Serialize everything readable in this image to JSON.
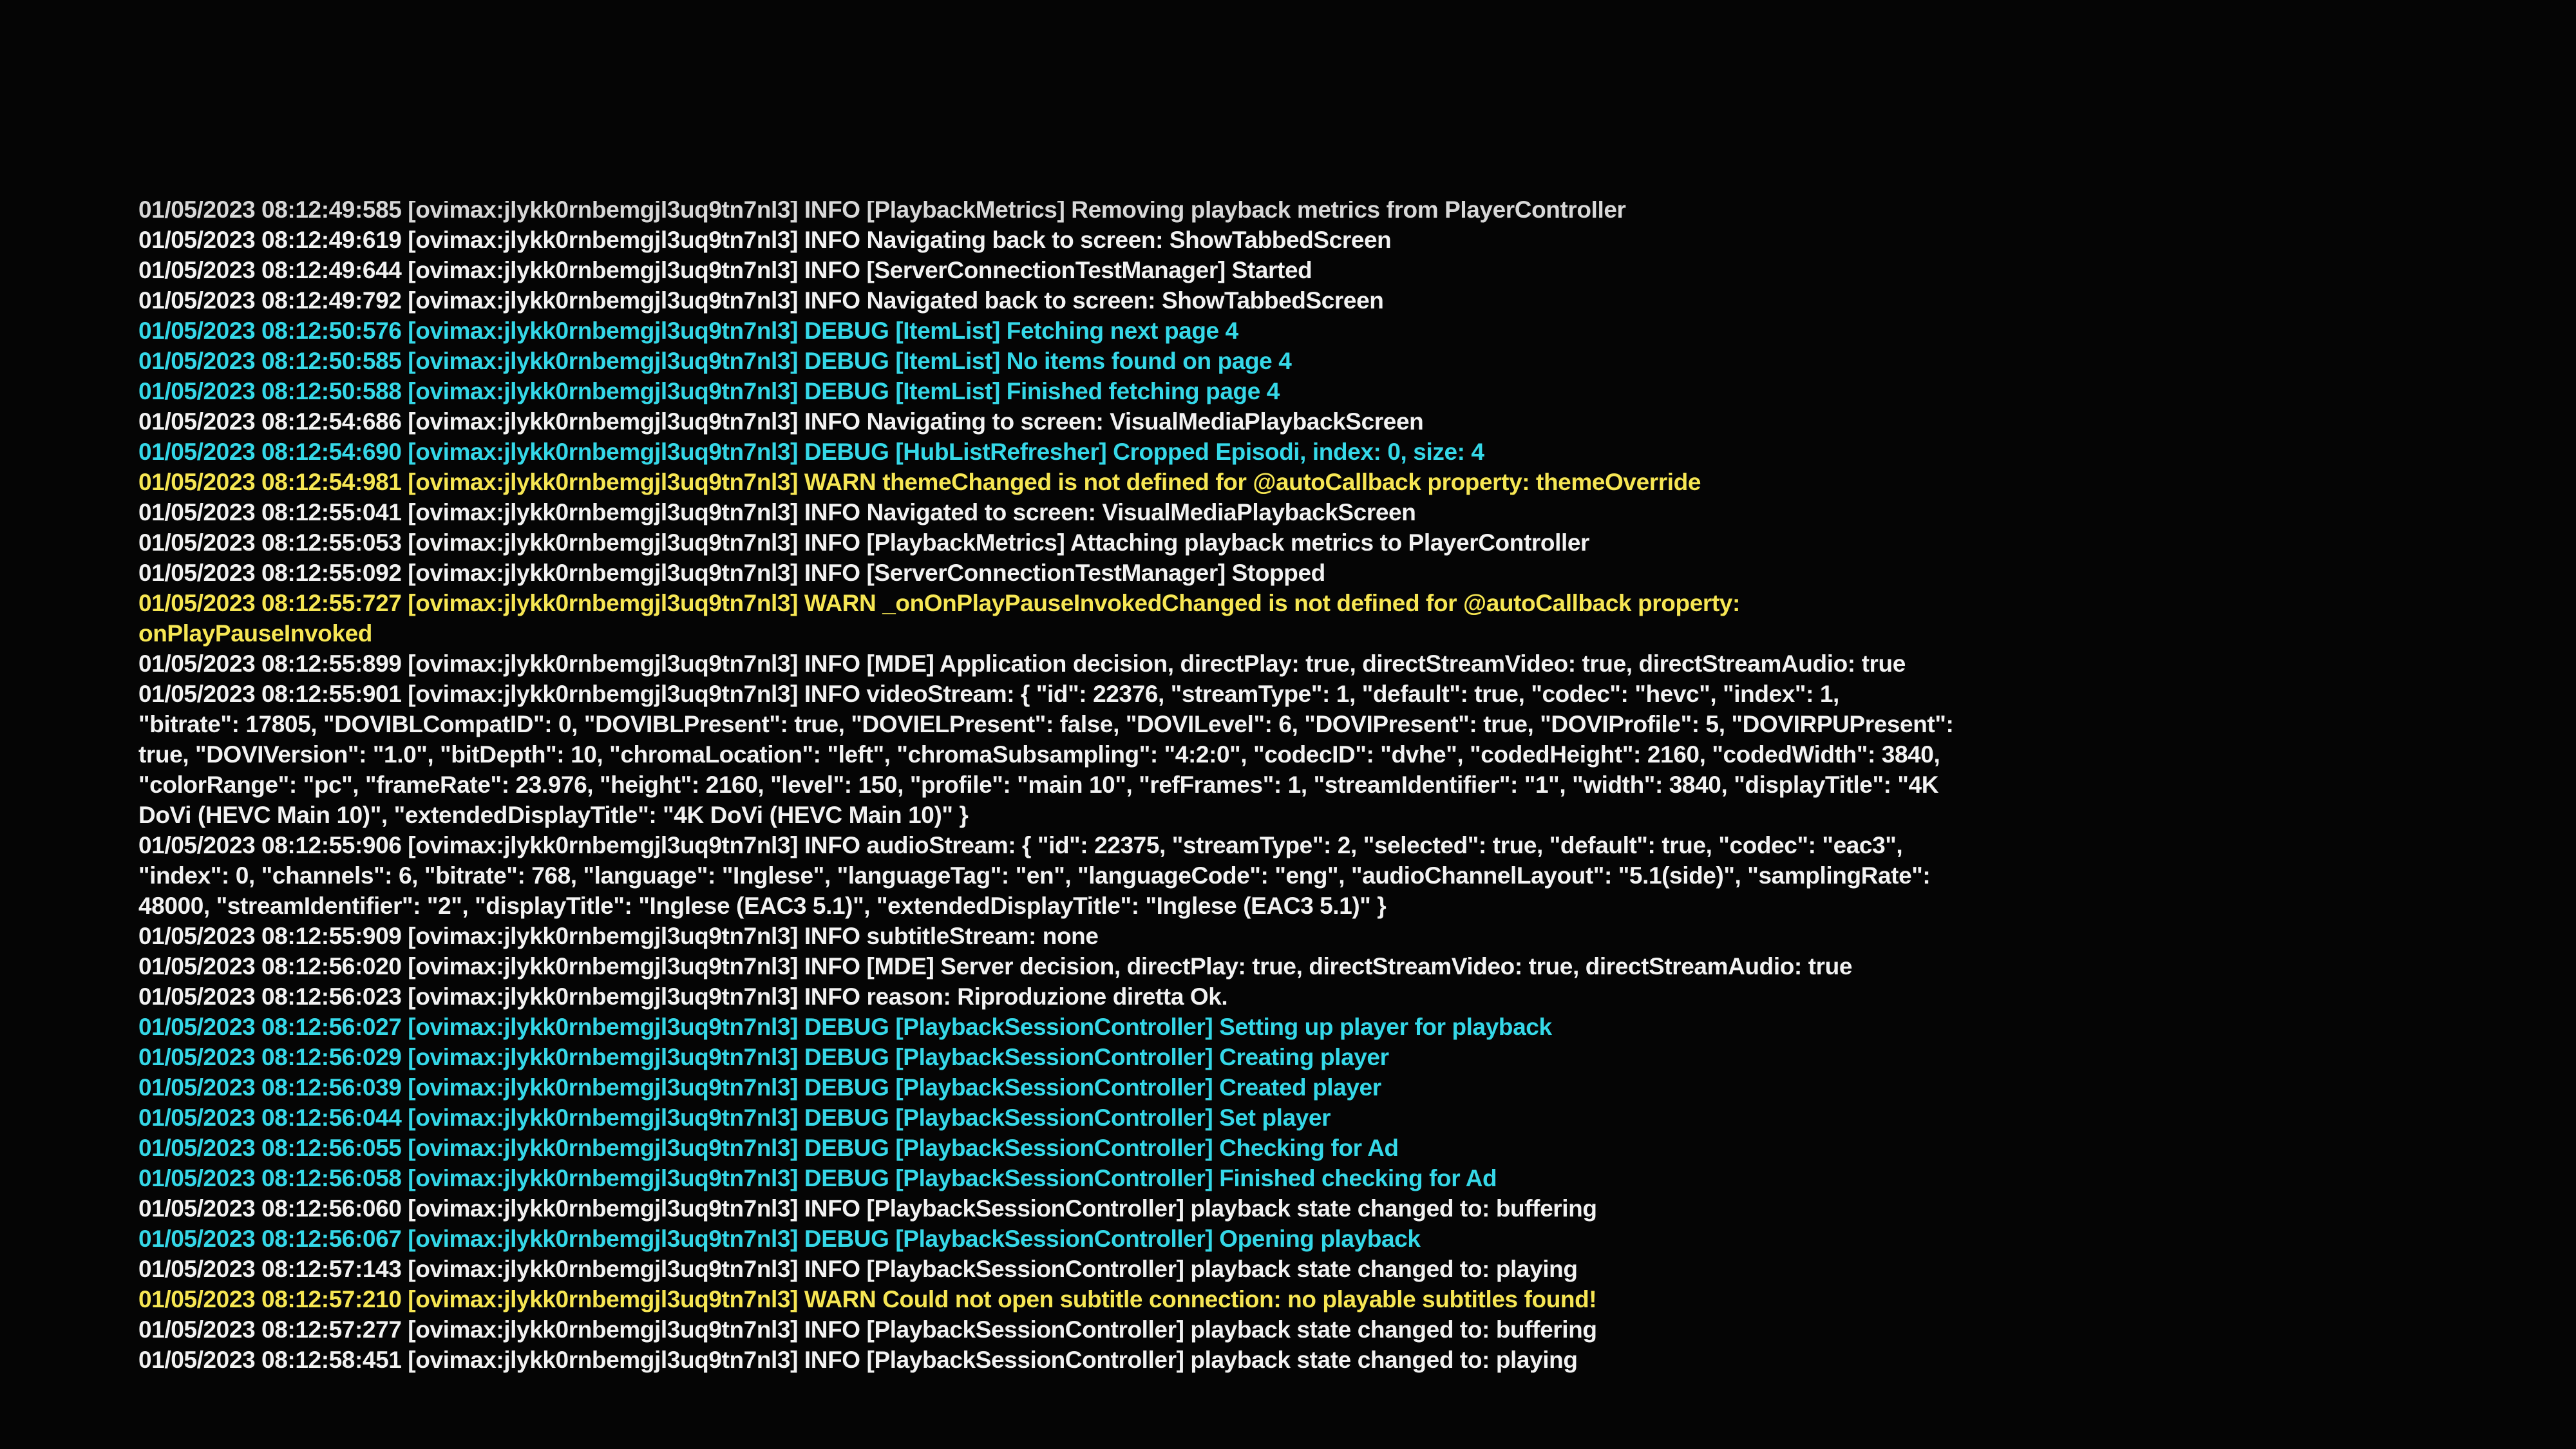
{
  "colors": {
    "background": "#050505",
    "info": "#f2f2f2",
    "debug": "#35d8e8",
    "warn": "#f6e653"
  },
  "log": {
    "lines": [
      {
        "level": "info",
        "text": "01/05/2023 08:12:49:585 [ovimax:jlykk0rnbemgjl3uq9tn7nl3] INFO [PlaybackMetrics] Removing playback metrics from PlayerController"
      },
      {
        "level": "info",
        "text": "01/05/2023 08:12:49:619 [ovimax:jlykk0rnbemgjl3uq9tn7nl3] INFO Navigating back to screen: ShowTabbedScreen"
      },
      {
        "level": "info",
        "text": "01/05/2023 08:12:49:644 [ovimax:jlykk0rnbemgjl3uq9tn7nl3] INFO [ServerConnectionTestManager] Started"
      },
      {
        "level": "info",
        "text": "01/05/2023 08:12:49:792 [ovimax:jlykk0rnbemgjl3uq9tn7nl3] INFO Navigated back to screen: ShowTabbedScreen"
      },
      {
        "level": "debug",
        "text": "01/05/2023 08:12:50:576 [ovimax:jlykk0rnbemgjl3uq9tn7nl3] DEBUG [ItemList] Fetching next page 4"
      },
      {
        "level": "debug",
        "text": "01/05/2023 08:12:50:585 [ovimax:jlykk0rnbemgjl3uq9tn7nl3] DEBUG [ItemList] No items found on page 4"
      },
      {
        "level": "debug",
        "text": "01/05/2023 08:12:50:588 [ovimax:jlykk0rnbemgjl3uq9tn7nl3] DEBUG [ItemList] Finished fetching page 4"
      },
      {
        "level": "info",
        "text": "01/05/2023 08:12:54:686 [ovimax:jlykk0rnbemgjl3uq9tn7nl3] INFO Navigating to screen: VisualMediaPlaybackScreen"
      },
      {
        "level": "debug",
        "text": "01/05/2023 08:12:54:690 [ovimax:jlykk0rnbemgjl3uq9tn7nl3] DEBUG [HubListRefresher] Cropped Episodi, index: 0, size: 4"
      },
      {
        "level": "warn",
        "text": "01/05/2023 08:12:54:981 [ovimax:jlykk0rnbemgjl3uq9tn7nl3] WARN themeChanged is not defined for @autoCallback property: themeOverride"
      },
      {
        "level": "info",
        "text": "01/05/2023 08:12:55:041 [ovimax:jlykk0rnbemgjl3uq9tn7nl3] INFO Navigated to screen: VisualMediaPlaybackScreen"
      },
      {
        "level": "info",
        "text": "01/05/2023 08:12:55:053 [ovimax:jlykk0rnbemgjl3uq9tn7nl3] INFO [PlaybackMetrics] Attaching playback metrics to PlayerController"
      },
      {
        "level": "info",
        "text": "01/05/2023 08:12:55:092 [ovimax:jlykk0rnbemgjl3uq9tn7nl3] INFO [ServerConnectionTestManager] Stopped"
      },
      {
        "level": "warn",
        "text": "01/05/2023 08:12:55:727 [ovimax:jlykk0rnbemgjl3uq9tn7nl3] WARN _onOnPlayPauseInvokedChanged is not defined for @autoCallback property:\nonPlayPauseInvoked"
      },
      {
        "level": "info",
        "text": "01/05/2023 08:12:55:899 [ovimax:jlykk0rnbemgjl3uq9tn7nl3] INFO [MDE] Application decision, directPlay: true, directStreamVideo: true, directStreamAudio: true"
      },
      {
        "level": "info",
        "text": "01/05/2023 08:12:55:901 [ovimax:jlykk0rnbemgjl3uq9tn7nl3] INFO videoStream: { \"id\": 22376, \"streamType\": 1, \"default\": true, \"codec\": \"hevc\", \"index\": 1,\n\"bitrate\": 17805, \"DOVIBLCompatID\": 0, \"DOVIBLPresent\": true, \"DOVIELPresent\": false, \"DOVILevel\": 6, \"DOVIPresent\": true, \"DOVIProfile\": 5, \"DOVIRPUPresent\":\ntrue, \"DOVIVersion\": \"1.0\", \"bitDepth\": 10, \"chromaLocation\": \"left\", \"chromaSubsampling\": \"4:2:0\", \"codecID\": \"dvhe\", \"codedHeight\": 2160, \"codedWidth\": 3840,\n\"colorRange\": \"pc\", \"frameRate\": 23.976, \"height\": 2160, \"level\": 150, \"profile\": \"main 10\", \"refFrames\": 1, \"streamIdentifier\": \"1\", \"width\": 3840, \"displayTitle\": \"4K\nDoVi (HEVC Main 10)\", \"extendedDisplayTitle\": \"4K DoVi (HEVC Main 10)\" }"
      },
      {
        "level": "info",
        "text": "01/05/2023 08:12:55:906 [ovimax:jlykk0rnbemgjl3uq9tn7nl3] INFO audioStream: { \"id\": 22375, \"streamType\": 2, \"selected\": true, \"default\": true, \"codec\": \"eac3\",\n\"index\": 0, \"channels\": 6, \"bitrate\": 768, \"language\": \"Inglese\", \"languageTag\": \"en\", \"languageCode\": \"eng\", \"audioChannelLayout\": \"5.1(side)\", \"samplingRate\":\n48000, \"streamIdentifier\": \"2\", \"displayTitle\": \"Inglese (EAC3 5.1)\", \"extendedDisplayTitle\": \"Inglese (EAC3 5.1)\" }"
      },
      {
        "level": "info",
        "text": "01/05/2023 08:12:55:909 [ovimax:jlykk0rnbemgjl3uq9tn7nl3] INFO subtitleStream: none"
      },
      {
        "level": "info",
        "text": "01/05/2023 08:12:56:020 [ovimax:jlykk0rnbemgjl3uq9tn7nl3] INFO [MDE] Server decision, directPlay: true, directStreamVideo: true, directStreamAudio: true"
      },
      {
        "level": "info",
        "text": "01/05/2023 08:12:56:023 [ovimax:jlykk0rnbemgjl3uq9tn7nl3] INFO reason: Riproduzione diretta Ok."
      },
      {
        "level": "debug",
        "text": "01/05/2023 08:12:56:027 [ovimax:jlykk0rnbemgjl3uq9tn7nl3] DEBUG [PlaybackSessionController] Setting up player for playback"
      },
      {
        "level": "debug",
        "text": "01/05/2023 08:12:56:029 [ovimax:jlykk0rnbemgjl3uq9tn7nl3] DEBUG [PlaybackSessionController] Creating player"
      },
      {
        "level": "debug",
        "text": "01/05/2023 08:12:56:039 [ovimax:jlykk0rnbemgjl3uq9tn7nl3] DEBUG [PlaybackSessionController] Created player"
      },
      {
        "level": "debug",
        "text": "01/05/2023 08:12:56:044 [ovimax:jlykk0rnbemgjl3uq9tn7nl3] DEBUG [PlaybackSessionController] Set player"
      },
      {
        "level": "debug",
        "text": "01/05/2023 08:12:56:055 [ovimax:jlykk0rnbemgjl3uq9tn7nl3] DEBUG [PlaybackSessionController] Checking for Ad"
      },
      {
        "level": "debug",
        "text": "01/05/2023 08:12:56:058 [ovimax:jlykk0rnbemgjl3uq9tn7nl3] DEBUG [PlaybackSessionController] Finished checking for Ad"
      },
      {
        "level": "info",
        "text": "01/05/2023 08:12:56:060 [ovimax:jlykk0rnbemgjl3uq9tn7nl3] INFO [PlaybackSessionController] playback state changed to: buffering"
      },
      {
        "level": "debug",
        "text": "01/05/2023 08:12:56:067 [ovimax:jlykk0rnbemgjl3uq9tn7nl3] DEBUG [PlaybackSessionController] Opening playback"
      },
      {
        "level": "info",
        "text": "01/05/2023 08:12:57:143 [ovimax:jlykk0rnbemgjl3uq9tn7nl3] INFO [PlaybackSessionController] playback state changed to: playing"
      },
      {
        "level": "warn",
        "text": "01/05/2023 08:12:57:210 [ovimax:jlykk0rnbemgjl3uq9tn7nl3] WARN Could not open subtitle connection: no playable subtitles found!"
      },
      {
        "level": "info",
        "text": "01/05/2023 08:12:57:277 [ovimax:jlykk0rnbemgjl3uq9tn7nl3] INFO [PlaybackSessionController] playback state changed to: buffering"
      },
      {
        "level": "info",
        "text": "01/05/2023 08:12:58:451 [ovimax:jlykk0rnbemgjl3uq9tn7nl3] INFO [PlaybackSessionController] playback state changed to: playing"
      }
    ]
  }
}
